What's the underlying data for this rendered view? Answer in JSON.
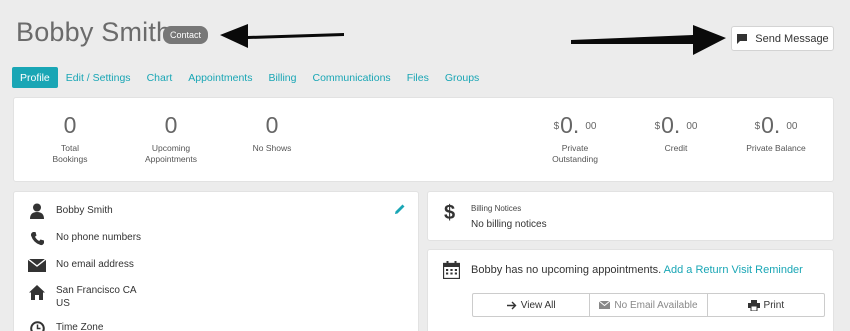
{
  "header": {
    "title": "Bobby Smith",
    "badge": "Contact",
    "send_message_label": "Send Message"
  },
  "tabs": [
    {
      "label": "Profile",
      "active": true
    },
    {
      "label": "Edit / Settings"
    },
    {
      "label": "Chart"
    },
    {
      "label": "Appointments"
    },
    {
      "label": "Billing"
    },
    {
      "label": "Communications"
    },
    {
      "label": "Files"
    },
    {
      "label": "Groups"
    }
  ],
  "stats": {
    "total_bookings": {
      "value": "0",
      "label_line1": "Total",
      "label_line2": "Bookings"
    },
    "upcoming": {
      "value": "0",
      "label_line1": "Upcoming",
      "label_line2": "Appointments"
    },
    "no_shows": {
      "value": "0",
      "label_line1": "No Shows"
    },
    "private_outstanding": {
      "currency": "$",
      "value": "0.",
      "cents": "00",
      "label_line1": "Private",
      "label_line2": "Outstanding"
    },
    "credit": {
      "currency": "$",
      "value": "0.",
      "cents": "00",
      "label_line1": "Credit"
    },
    "private_balance": {
      "currency": "$",
      "value": "0.",
      "cents": "00",
      "label_line1": "Private Balance"
    }
  },
  "contact": {
    "name": "Bobby Smith",
    "phone": "No phone numbers",
    "email": "No email address",
    "address_line1": "San Francisco CA",
    "address_line2": "US",
    "time_zone": "Time Zone"
  },
  "billing": {
    "title": "Billing Notices",
    "text": "No billing notices"
  },
  "appointments": {
    "message": "Bobby has no upcoming appointments.",
    "link": "Add a Return Visit Reminder",
    "view_all": "View All",
    "no_email": "No Email Available",
    "print": "Print"
  },
  "colors": {
    "accent": "#19a6b5",
    "badge": "#777777",
    "background": "#ececec"
  },
  "icons": {
    "send": "speech-bubble-icon",
    "edit": "pencil-icon",
    "person": "person-icon",
    "phone": "phone-icon",
    "email": "envelope-icon",
    "home": "home-icon",
    "clock": "clock-icon",
    "dollar": "dollar-icon",
    "calendar": "calendar-icon",
    "arrow_right": "arrow-right-icon",
    "printer": "printer-icon"
  }
}
